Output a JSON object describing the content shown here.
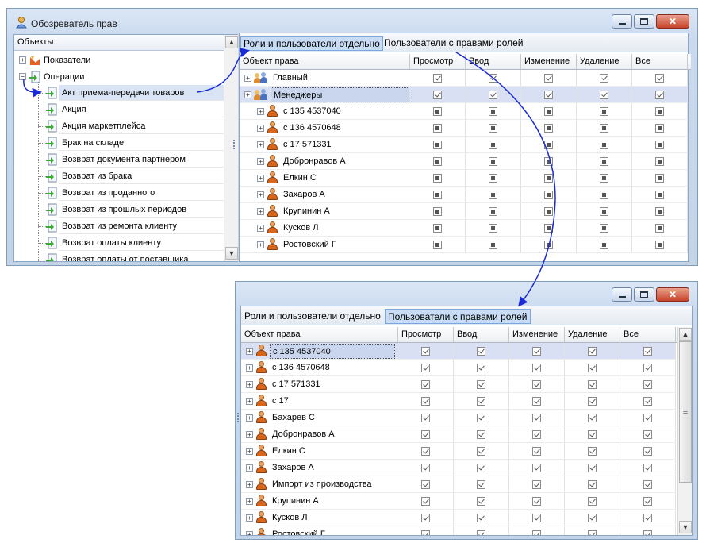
{
  "window1": {
    "title": "Обозреватель прав",
    "buttons": {
      "close": "✕"
    }
  },
  "objects_panel": {
    "header": "Объекты",
    "tree": [
      {
        "label": "Показатели",
        "expander": "+"
      },
      {
        "label": "Операции",
        "expander": "−"
      }
    ],
    "leaves": [
      "Акт приема-передачи товаров",
      "Акция",
      "Акция маркетплейса",
      "Брак на складе",
      "Возврат документа партнером",
      "Возврат из брака",
      "Возврат из проданного",
      "Возврат из прошлых периодов",
      "Возврат из ремонта клиенту",
      "Возврат оплаты клиенту",
      "Возврат оплаты от поставщика"
    ]
  },
  "tabs": {
    "roles_separately": "Роли и пользователи отдельно",
    "users_with_roles": "Пользователи с правами ролей"
  },
  "columns": [
    "Объект права",
    "Просмотр",
    "Ввод",
    "Изменение",
    "Удаление",
    "Все"
  ],
  "grid1": {
    "rows": [
      {
        "name": "Главный",
        "type": "group",
        "state": "check"
      },
      {
        "name": "Менеджеры",
        "type": "group",
        "state": "check",
        "selected": true
      },
      {
        "name": "с 135 4537040",
        "type": "user",
        "state": "ind"
      },
      {
        "name": "с 136 4570648",
        "type": "user",
        "state": "ind"
      },
      {
        "name": "с 17 571331",
        "type": "user",
        "state": "ind"
      },
      {
        "name": "Добронравов А",
        "type": "user",
        "state": "ind"
      },
      {
        "name": "Елкин С",
        "type": "user",
        "state": "ind"
      },
      {
        "name": "Захаров А",
        "type": "user",
        "state": "ind"
      },
      {
        "name": "Крупинин А",
        "type": "user",
        "state": "ind"
      },
      {
        "name": "Кусков Л",
        "type": "user",
        "state": "ind"
      },
      {
        "name": "Ростовский Г",
        "type": "user",
        "state": "ind"
      }
    ]
  },
  "grid2": {
    "rows": [
      {
        "name": "с 135 4537040",
        "selected": true
      },
      {
        "name": "с 136 4570648"
      },
      {
        "name": "с 17 571331"
      },
      {
        "name": "с 17"
      },
      {
        "name": "Бахарев С"
      },
      {
        "name": "Добронравов А"
      },
      {
        "name": "Елкин С"
      },
      {
        "name": "Захаров А"
      },
      {
        "name": "Импорт из производства"
      },
      {
        "name": "Крупинин А"
      },
      {
        "name": "Кусков Л"
      },
      {
        "name": "Ростовский Г"
      }
    ]
  },
  "colors": {
    "arrow": "#1a2bd6",
    "selected_row": "#d9e0f3",
    "active_tab": "#c8dcf5"
  }
}
